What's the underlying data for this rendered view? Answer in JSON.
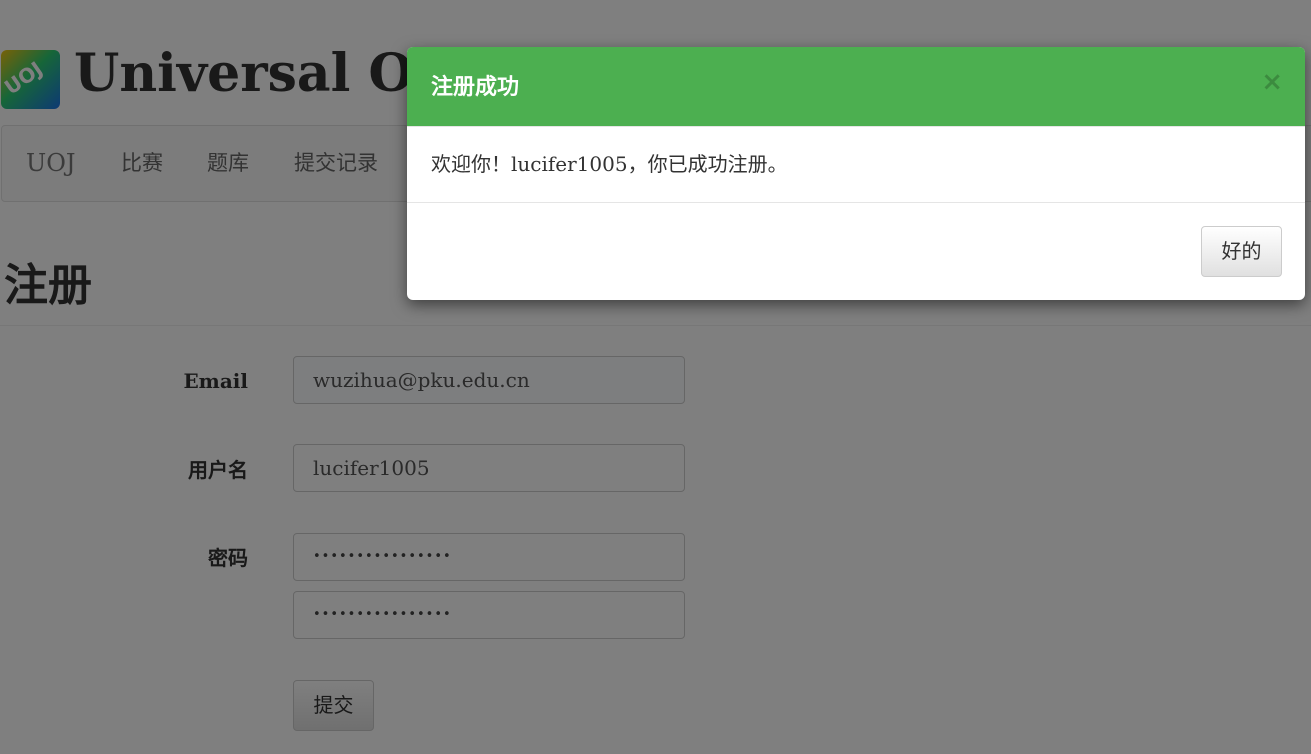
{
  "site": {
    "logo_text": "UOJ",
    "title": "Universal Online Judge"
  },
  "nav": {
    "brand": "UOJ",
    "items": [
      {
        "label": "比赛"
      },
      {
        "label": "题库"
      },
      {
        "label": "提交记录"
      }
    ]
  },
  "page": {
    "heading": "注册"
  },
  "form": {
    "email_label": "Email",
    "email_value": "wuzihua@pku.edu.cn",
    "username_label": "用户名",
    "username_value": "lucifer1005",
    "password_label": "密码",
    "password_masked": "••••••••••••••••",
    "password_confirm_masked": "••••••••••••••••",
    "submit_label": "提交"
  },
  "modal": {
    "title": "注册成功",
    "close_symbol": "×",
    "message": "欢迎你！lucifer1005，你已成功注册。",
    "ok_label": "好的",
    "header_color": "#4caf50"
  }
}
